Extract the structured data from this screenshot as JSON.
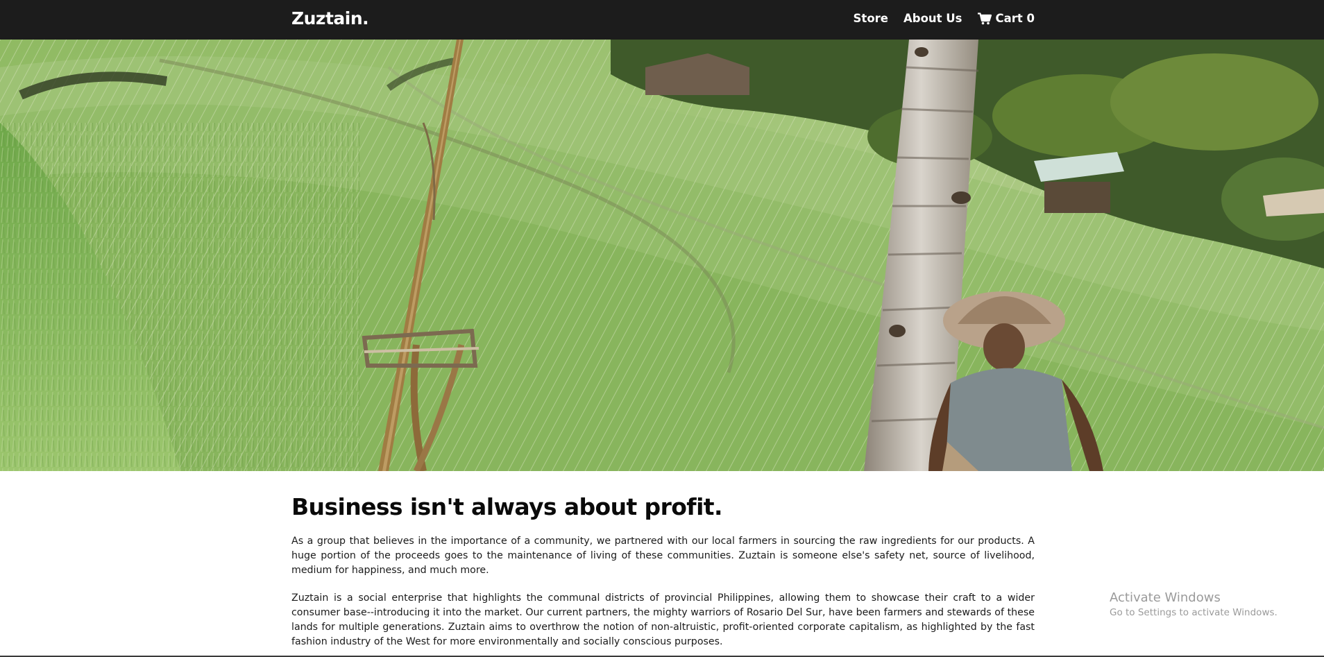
{
  "navbar": {
    "brand": "Zuztain.",
    "links": [
      {
        "label": "Store"
      },
      {
        "label": "About Us"
      },
      {
        "label": "Cart 0",
        "icon": "shopping-cart-icon"
      }
    ],
    "background": "#1c1c1c"
  },
  "hero": {
    "alt_subject": "farmer in rice terraces"
  },
  "about": {
    "heading": "Business isn't always about profit.",
    "paragraphs": [
      "As a group that believes in the importance of a community, we partnered with our local farmers in sourcing the raw ingredients for our products. A huge portion of the proceeds goes to the maintenance of living of these communities. Zuztain is someone else's safety net, source of livelihood, medium for happiness, and much more.",
      "Zuztain is a social enterprise that highlights the communal districts of provincial Philippines, allowing them to showcase their craft to a wider consumer base--introducing it into the market. Our current partners, the mighty warriors of Rosario Del Sur, have been farmers and stewards of these lands for multiple generations. Zuztain aims to overthrow the notion of non-altruistic, profit-oriented corporate capitalism, as highlighted by the fast fashion industry of the West for more environmentally and socially conscious purposes."
    ]
  },
  "watermark": {
    "title": "Activate Windows",
    "subtitle": "Go to Settings to activate Windows."
  }
}
